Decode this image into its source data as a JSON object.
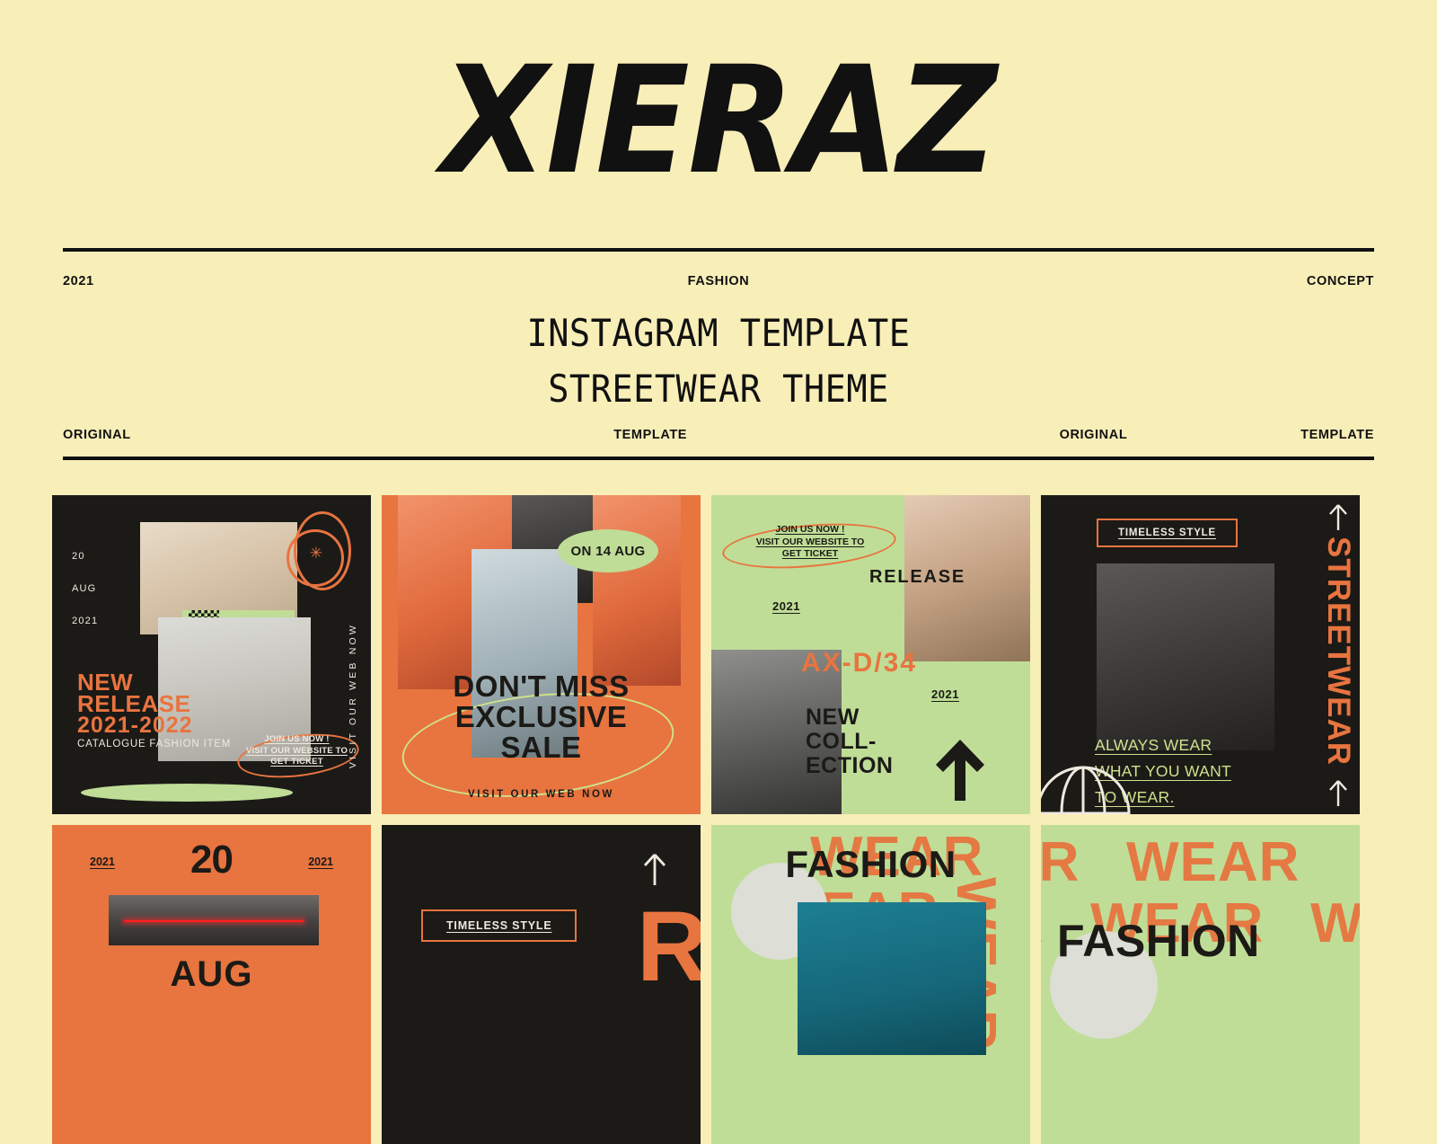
{
  "colors": {
    "background": "#f8eeb8",
    "dark": "#1b1a17",
    "orange": "#e8743f",
    "green": "#bfdd96",
    "cream_text": "#efe9df",
    "lime_text": "#cfe08b"
  },
  "header": {
    "brand": "XIERAZ",
    "meta_top": {
      "left": "2021",
      "middle": "FASHION",
      "right": "CONCEPT"
    },
    "subtitle_line1": "INSTAGRAM TEMPLATE",
    "subtitle_line2": "STREETWEAR THEME",
    "meta_bottom": [
      "ORIGINAL",
      "TEMPLATE",
      "ORIGINAL",
      "TEMPLATE"
    ]
  },
  "cards": [
    {
      "id": "card-new-release",
      "theme": "dark",
      "date": {
        "day": "20",
        "month": "AUG",
        "year": "2021"
      },
      "headline_line1": "NEW",
      "headline_line2": "RELEASE",
      "headline_line3": "2021-2022",
      "caption": "CATALOGUE FASHION ITEM",
      "cta_line1": "JOIN US NOW !",
      "cta_line2": "VISIT OUR WEBSITE TO",
      "cta_line3": "GET TICKET",
      "vertical_text": "VISIT OUR WEB NOW",
      "star_glyph": "✳"
    },
    {
      "id": "card-exclusive-sale",
      "theme": "orange",
      "badge": "ON 14 AUG",
      "headline_line1": "DON'T MISS",
      "headline_line2": "EXCLUSIVE",
      "headline_line3": "SALE",
      "footer": "VISIT OUR WEB NOW"
    },
    {
      "id": "card-new-collection",
      "theme": "green",
      "cta_line1": "JOIN US NOW !",
      "cta_line2": "VISIT OUR WEBSITE TO",
      "cta_line3": "GET TICKET",
      "release_label": "RELEASE",
      "year_top": "2021",
      "code": "AX-D/34",
      "year_bottom": "2021",
      "headline_line1": "NEW",
      "headline_line2": "COLL-",
      "headline_line3": "ECTION",
      "arrow_glyph": "arrow-up"
    },
    {
      "id": "card-timeless-style",
      "theme": "dark",
      "tag": "TIMELESS STYLE",
      "quote_line1": "ALWAYS WEAR",
      "quote_line2": "WHAT YOU WANT",
      "quote_line3": "TO WEAR.",
      "vertical_text": "STREETWEAR",
      "arrow_top": "↑",
      "arrow_bottom": "↑"
    },
    {
      "id": "card-20-aug",
      "theme": "orange",
      "year_left": "2021",
      "year_right": "2021",
      "day": "20",
      "month": "AUG"
    },
    {
      "id": "card-timeless-style-2",
      "theme": "dark",
      "tag": "TIMELESS STYLE",
      "big_letter": "R",
      "arrow": "↑"
    },
    {
      "id": "card-fashion-wear",
      "theme": "green",
      "title": "FASHION",
      "pattern_word": "WEAR"
    },
    {
      "id": "card-fashion-wear-2",
      "theme": "green",
      "title": "FASHION",
      "pattern_word": "WEAR"
    }
  ]
}
